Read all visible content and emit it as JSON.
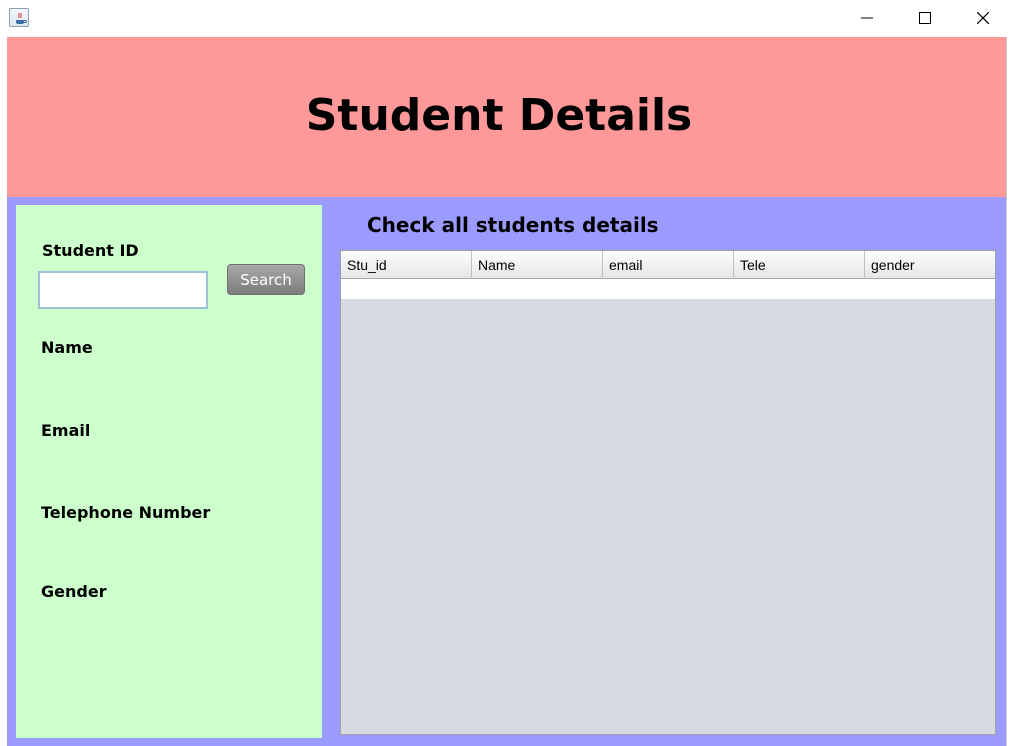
{
  "window": {
    "controls": {
      "minimize": "minimize-icon",
      "maximize": "maximize-icon",
      "close": "close-icon"
    }
  },
  "header": {
    "title": "Student Details",
    "background": "#ff9999"
  },
  "form": {
    "student_id_label": "Student ID",
    "student_id_value": "",
    "search_label": "Search",
    "name_label": "Name",
    "email_label": "Email",
    "telephone_label": "Telephone Number",
    "gender_label": "Gender",
    "background": "#ccffcc"
  },
  "table": {
    "caption": "Check all students details",
    "columns": [
      "Stu_id",
      "Name",
      "email",
      "Tele",
      "gender"
    ],
    "rows": []
  },
  "colors": {
    "body_background": "#9b9bfe",
    "table_background": "#d6d9e0"
  }
}
